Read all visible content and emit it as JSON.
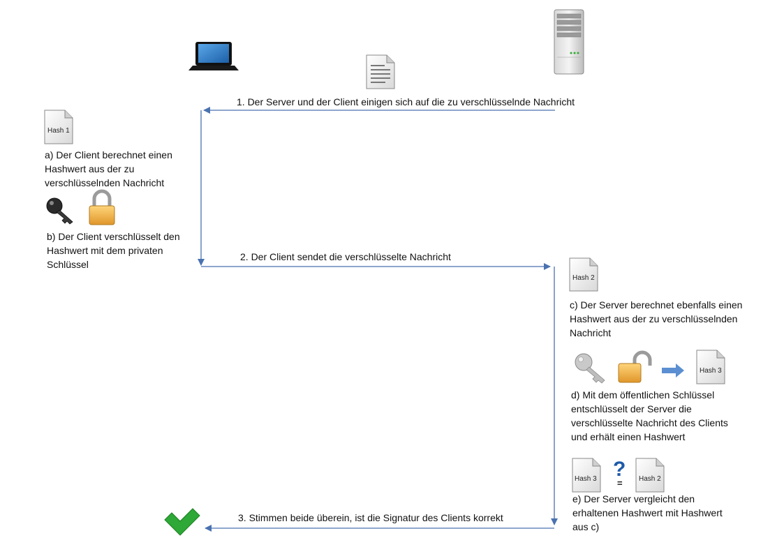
{
  "steps": {
    "step1": "1. Der Server und der Client einigen sich auf die zu verschlüsselnde Nachricht",
    "step2": "2. Der Client sendet die verschlüsselte Nachricht",
    "step3": "3. Stimmen beide überein, ist die Signatur des Clients korrekt"
  },
  "client": {
    "a": "a) Der Client berechnet einen\nHashwert aus der zu\nverschlüsselnden Nachricht",
    "b": "b) Der Client  verschlüsselt den\nHashwert mit dem privaten\nSchlüssel",
    "hash_label": "Hash 1"
  },
  "server": {
    "c": "c) Der Server berechnet ebenfalls einen\nHashwert aus der zu verschlüsselnden\nNachricht",
    "d": "d) Mit dem öffentlichen Schlüssel\nentschlüsselt der Server die\nverschlüsselte Nachricht des Clients\nund erhält einen Hashwert",
    "e": "e) Der Server  vergleicht den\nerhaltenen Hashwert mit Hashwert\naus  c)",
    "hash2_label": "Hash 2",
    "hash3_label": "Hash 3",
    "compare_symbol": "?",
    "equals_symbol": "="
  },
  "icons": {
    "laptop": "laptop-icon",
    "server": "server-icon",
    "message": "document-icon",
    "private_key": "key-icon",
    "lock": "lock-closed-icon",
    "public_key": "key-icon",
    "unlock": "lock-open-icon",
    "check": "checkmark-icon"
  },
  "colors": {
    "arrow": "#4a72b0",
    "lock_gold": "#f2b64a",
    "check_green": "#2ea836",
    "question_blue": "#1e5aa8"
  }
}
